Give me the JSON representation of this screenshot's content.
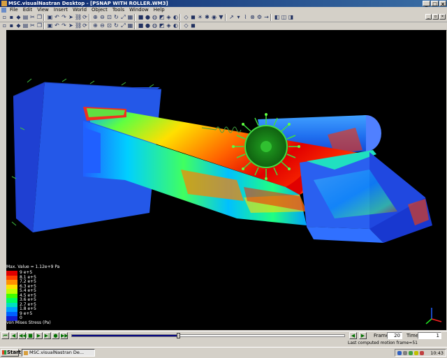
{
  "window": {
    "title": "MSC.visualNastran Desktop - [PSNAP WITH ROLLER.WM3]"
  },
  "menu": [
    "File",
    "Edit",
    "View",
    "Insert",
    "World",
    "Object",
    "Tools",
    "Window",
    "Help"
  ],
  "toolbar1_icons": [
    "new-icon",
    "open-icon",
    "save-icon",
    "print-icon",
    "cut-icon",
    "copy-icon",
    "paste-icon",
    "undo-icon",
    "redo-icon",
    "pointer-icon",
    "link-icon",
    "rotate-icon",
    "zoom-in-icon",
    "zoom-out-icon",
    "zoom-window-icon",
    "refresh-icon",
    "fit-icon",
    "grid-icon",
    "box-icon",
    "cylinder-icon",
    "sphere-icon",
    "extrude-icon",
    "mesh-icon",
    "color-icon",
    "wireframe-icon",
    "shade-icon",
    "light-icon",
    "light-alt-icon",
    "camera-icon",
    "filter-icon",
    "arrow-icon",
    "select-dropdown-icon",
    "spring-icon",
    "joint-icon",
    "motor-icon",
    "force-icon",
    "object-icon",
    "box2-icon",
    "box3-icon"
  ],
  "toolbar2_icons": [
    "pan-icon",
    "orbit-icon",
    "walk-icon",
    "fly-icon",
    "zoom-icon",
    "dolly-icon",
    "view-icon",
    "camera-view-icon",
    "grid-view-icon",
    "perspective-icon",
    "front-icon",
    "top-icon",
    "side-icon",
    "iso-icon",
    "render-icon",
    "flat-icon",
    "arrow-select-icon",
    "move-icon",
    "rotate-obj-icon",
    "scale-icon",
    "snap-icon",
    "align-icon",
    "point-icon",
    "coord-icon",
    "measure-icon",
    "attach-icon"
  ],
  "legend": {
    "max_value": "Max. Value = 1.12e+9 Pa",
    "quantity": "von Mises Stress (Pa)",
    "entries": [
      {
        "label": "9     e+5",
        "color": "#e00000"
      },
      {
        "label": "8.1   e+5",
        "color": "#ff4000"
      },
      {
        "label": "7.2   e+5",
        "color": "#ff9000"
      },
      {
        "label": "6.3   e+5",
        "color": "#ffe000"
      },
      {
        "label": "5.4   e+5",
        "color": "#c0ff00"
      },
      {
        "label": "4.5   e+5",
        "color": "#40ff00"
      },
      {
        "label": "3.6   e+5",
        "color": "#00ff60"
      },
      {
        "label": "2.7   e+5",
        "color": "#00e0c0"
      },
      {
        "label": "1.8   e+5",
        "color": "#00a0ff"
      },
      {
        "label": "9     e+5",
        "color": "#0060ff"
      },
      {
        "label": "0",
        "color": "#1020d0"
      }
    ]
  },
  "playback": {
    "buttons": [
      "reset-icon",
      "step-back-icon",
      "rewind-icon",
      "stop-icon",
      "play-icon",
      "step-forward-icon",
      "record-icon",
      "fast-forward-icon"
    ],
    "position": 0.39,
    "frame_label": "Frame:",
    "frame_value": "20",
    "time_label": "Time:",
    "time_value": "1"
  },
  "status": {
    "message": "Last computed motion frame=51"
  },
  "taskbar": {
    "start": "Start",
    "task": "MSC.visualNastran De...",
    "clock": "10:43"
  }
}
